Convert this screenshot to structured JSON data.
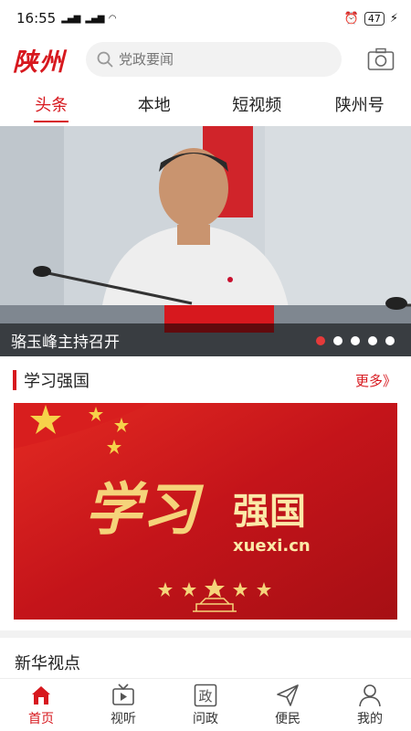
{
  "status": {
    "time": "16:55",
    "signal1": "4G",
    "signal2": "4G",
    "wifi": "wifi-icon",
    "battery": "47"
  },
  "header": {
    "logo": "陕州",
    "search_placeholder": "党政要闻",
    "camera": "camera-icon"
  },
  "tabs": [
    {
      "label": "头条",
      "active": true
    },
    {
      "label": "本地",
      "active": false
    },
    {
      "label": "短视频",
      "active": false
    },
    {
      "label": "陕州号",
      "active": false
    }
  ],
  "carousel": {
    "caption": "骆玉峰主持召开",
    "slides": 5,
    "active_index": 0
  },
  "section": {
    "title": "学习强国",
    "more": "更多》"
  },
  "banner": {
    "script_text": "学习",
    "title": "强国",
    "url_text": "xuexi.cn"
  },
  "next_section": {
    "title": "新华视点"
  },
  "colors": {
    "accent": "#d7181e",
    "banner_red": "#c4141a",
    "gold": "#f5d37a"
  },
  "bottom_nav": [
    {
      "label": "首页",
      "icon": "home-icon",
      "active": true
    },
    {
      "label": "视听",
      "icon": "tv-icon",
      "active": false
    },
    {
      "label": "问政",
      "icon": "zheng-icon",
      "active": false
    },
    {
      "label": "便民",
      "icon": "send-icon",
      "active": false
    },
    {
      "label": "我的",
      "icon": "user-icon",
      "active": false
    }
  ],
  "nav_glyphs": {
    "zheng": "政"
  }
}
